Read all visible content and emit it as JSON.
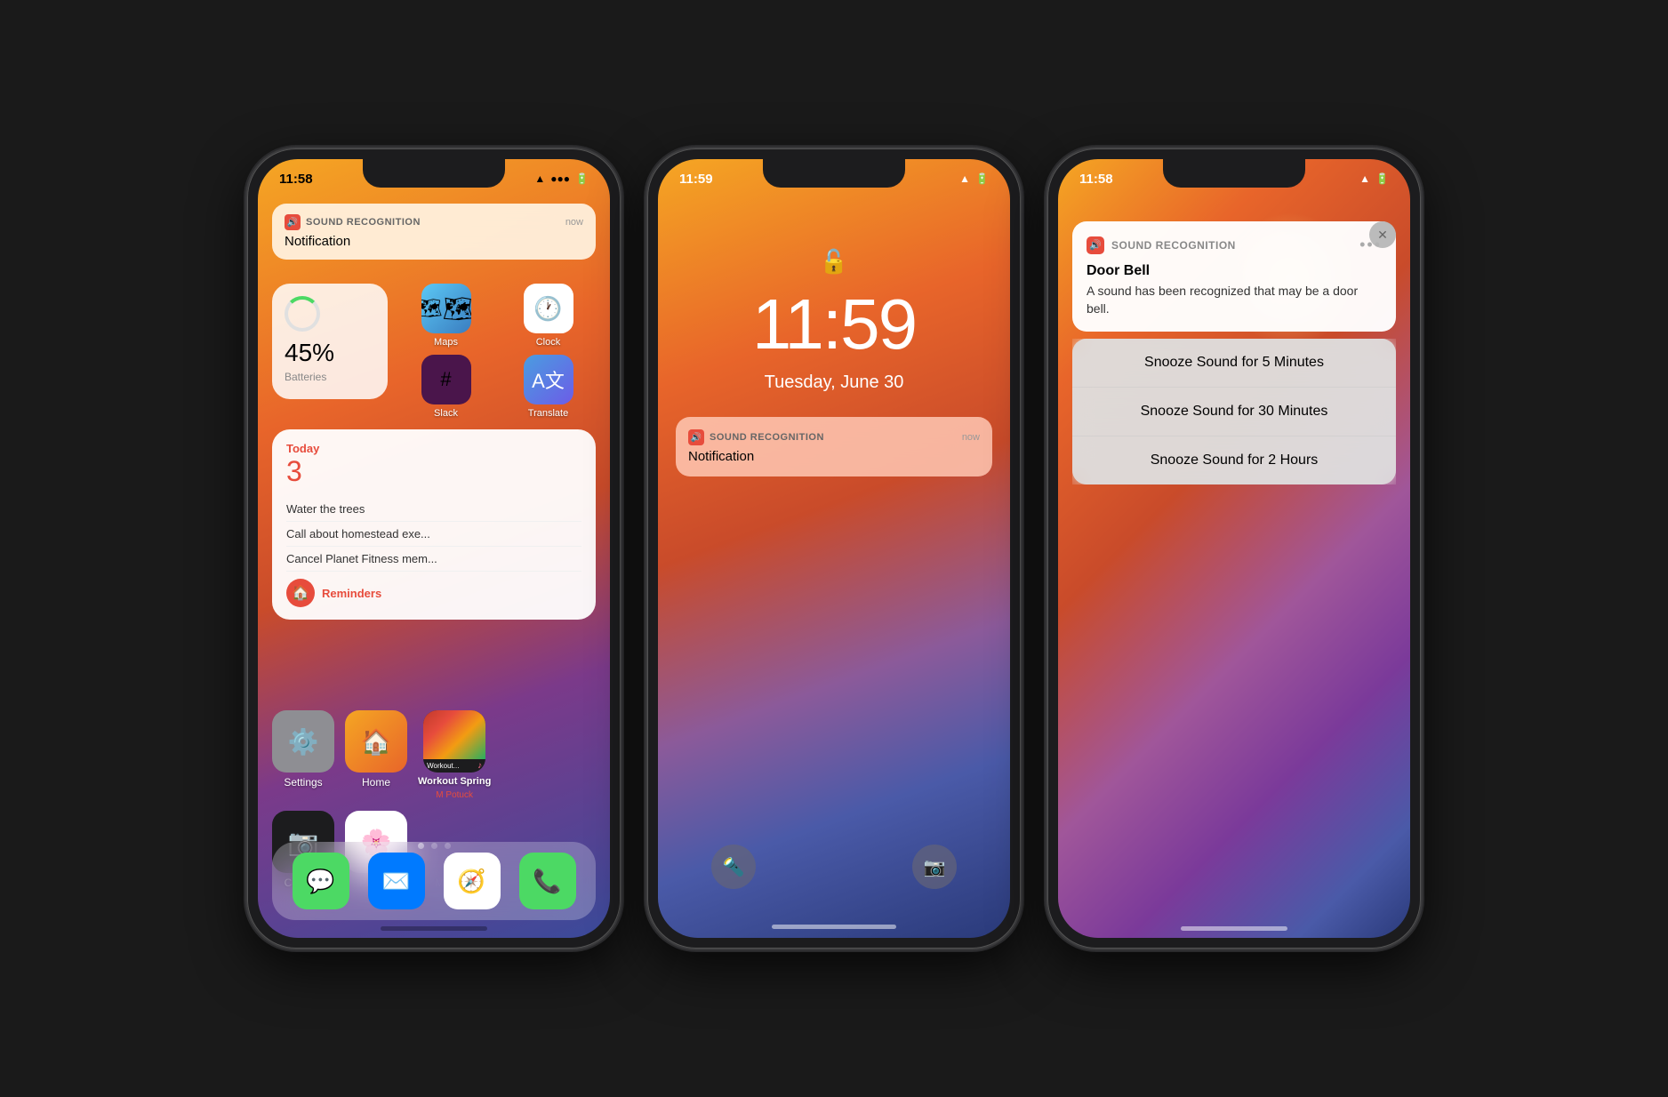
{
  "phone1": {
    "status": {
      "time": "11:58",
      "wifi": "wifi",
      "battery": "battery"
    },
    "notification": {
      "app_name": "SOUND RECOGNITION",
      "time": "now",
      "message": "Notification"
    },
    "battery_widget": {
      "label": "Batteries",
      "percentage": "45%",
      "fill_width": "45"
    },
    "apps_grid": [
      {
        "name": "Maps",
        "emoji": "🗺️",
        "bg": "#4a9de0"
      },
      {
        "name": "Clock",
        "emoji": "🕐",
        "bg": "#ffffff"
      },
      {
        "name": "Slack",
        "emoji": "💬",
        "bg": "#4a154b"
      },
      {
        "name": "Translate",
        "emoji": "🌐",
        "bg": "#4a9de0"
      }
    ],
    "reminders": {
      "day_label": "Today",
      "count": "3",
      "items": [
        "Water the trees",
        "Call about homestead exe...",
        "Cancel Planet Fitness mem..."
      ],
      "section_label": "Reminders"
    },
    "bottom_apps": [
      {
        "name": "Settings",
        "emoji": "⚙️",
        "bg": "#8e8e93"
      },
      {
        "name": "Home",
        "emoji": "🏠",
        "bg": "#f5a623"
      },
      {
        "name": "Music",
        "emoji": "🎵",
        "bg": "#1c1c1e"
      }
    ],
    "bottom_row_apps2": [
      {
        "name": "Camera",
        "emoji": "📷",
        "bg": "#1c1c1e"
      },
      {
        "name": "Photos",
        "emoji": "📸",
        "bg": "#fff"
      }
    ],
    "dock": [
      {
        "name": "Messages",
        "emoji": "💬",
        "bg": "#4cd964"
      },
      {
        "name": "Mail",
        "emoji": "✉️",
        "bg": "#007aff"
      },
      {
        "name": "Safari",
        "emoji": "🧭",
        "bg": "#fff"
      },
      {
        "name": "Phone",
        "emoji": "📞",
        "bg": "#4cd964"
      }
    ]
  },
  "phone2": {
    "status": {
      "time": "11:59",
      "wifi": "wifi",
      "battery": "battery"
    },
    "lock": {
      "time": "11:59",
      "date": "Tuesday, June 30",
      "lock_icon": "🔓"
    },
    "notification": {
      "app_name": "SOUND RECOGNITION",
      "time": "now",
      "message": "Notification"
    },
    "flashlight_icon": "🔦",
    "camera_icon": "📷"
  },
  "phone3": {
    "status": {
      "time": "11:58",
      "wifi": "wifi",
      "battery": "battery"
    },
    "notification": {
      "app_name": "SOUND RECOGNITION",
      "more_btn": "•••",
      "title": "Door Bell",
      "body": "A sound has been recognized that may be a door bell."
    },
    "close_btn": "✕",
    "snooze_options": [
      "Snooze Sound for 5 Minutes",
      "Snooze Sound for 30 Minutes",
      "Snooze Sound for 2 Hours"
    ]
  }
}
